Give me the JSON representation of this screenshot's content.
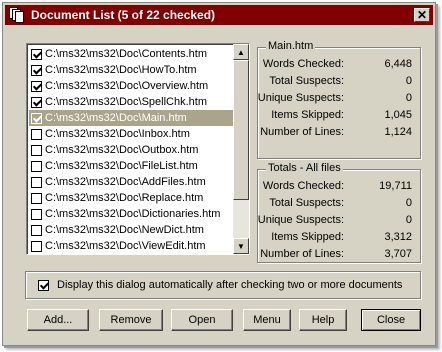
{
  "window": {
    "title": "Document List (5 of 22 checked)",
    "close_glyph": "✕"
  },
  "files": [
    {
      "path": "C:\\ms32\\ms32\\Doc\\Contents.htm",
      "checked": true,
      "selected": false
    },
    {
      "path": "C:\\ms32\\ms32\\Doc\\HowTo.htm",
      "checked": true,
      "selected": false
    },
    {
      "path": "C:\\ms32\\ms32\\Doc\\Overview.htm",
      "checked": true,
      "selected": false
    },
    {
      "path": "C:\\ms32\\ms32\\Doc\\SpellChk.htm",
      "checked": true,
      "selected": false
    },
    {
      "path": "C:\\ms32\\ms32\\Doc\\Main.htm",
      "checked": true,
      "selected": true
    },
    {
      "path": "C:\\ms32\\ms32\\Doc\\Inbox.htm",
      "checked": false,
      "selected": false
    },
    {
      "path": "C:\\ms32\\ms32\\Doc\\Outbox.htm",
      "checked": false,
      "selected": false
    },
    {
      "path": "C:\\ms32\\ms32\\Doc\\FileList.htm",
      "checked": false,
      "selected": false
    },
    {
      "path": "C:\\ms32\\ms32\\Doc\\AddFiles.htm",
      "checked": false,
      "selected": false
    },
    {
      "path": "C:\\ms32\\ms32\\Doc\\Replace.htm",
      "checked": false,
      "selected": false
    },
    {
      "path": "C:\\ms32\\ms32\\Doc\\Dictionaries.htm",
      "checked": false,
      "selected": false
    },
    {
      "path": "C:\\ms32\\ms32\\Doc\\NewDict.htm",
      "checked": false,
      "selected": false
    },
    {
      "path": "C:\\ms32\\ms32\\Doc\\ViewEdit.htm",
      "checked": false,
      "selected": false
    }
  ],
  "scrollbar": {
    "up": "▲",
    "down": "▼"
  },
  "main_stats": {
    "title": "Main.htm",
    "rows": [
      {
        "label": "Words Checked:",
        "value": "6,448"
      },
      {
        "label": "Total Suspects:",
        "value": "0"
      },
      {
        "label": "Unique Suspects:",
        "value": "0"
      },
      {
        "label": "Items Skipped:",
        "value": "1,045"
      },
      {
        "label": "Number of Lines:",
        "value": "1,124"
      }
    ]
  },
  "totals_stats": {
    "title": "Totals - All files",
    "rows": [
      {
        "label": "Words Checked:",
        "value": "19,711"
      },
      {
        "label": "Total Suspects:",
        "value": "0"
      },
      {
        "label": "Unique Suspects:",
        "value": "0"
      },
      {
        "label": "Items Skipped:",
        "value": "3,312"
      },
      {
        "label": "Number of Lines:",
        "value": "3,707"
      }
    ]
  },
  "option": {
    "label": "Display this dialog automatically after checking two or more documents",
    "checked": true
  },
  "buttons": {
    "add": "Add...",
    "remove": "Remove",
    "open": "Open",
    "menu": "Menu",
    "help": "Help",
    "close": "Close"
  }
}
